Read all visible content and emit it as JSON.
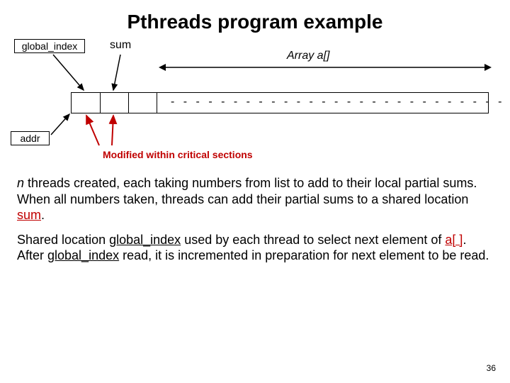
{
  "title": "Pthreads program example",
  "labels": {
    "global_index": "global_index",
    "sum": "sum",
    "array_a": "Array a[]",
    "addr": "addr",
    "caption": "Modified within critical sections"
  },
  "paragraphs": {
    "p1_italic_n": "n",
    "p1_rest": " threads created, each taking numbers from list to add to their local partial sums. When all numbers taken, threads can add their partial sums to a shared location ",
    "p1_sum": "sum",
    "p1_period": ".",
    "p2_a": "Shared location ",
    "p2_global_index": "global_index",
    "p2_b": " used by each thread to select next element of ",
    "p2_arr": "a[ ]",
    "p2_c": ". After ",
    "p2_global_index2": "global_index",
    "p2_d": " read, it is incremented in preparation for next element to be read."
  },
  "page_number": "36"
}
